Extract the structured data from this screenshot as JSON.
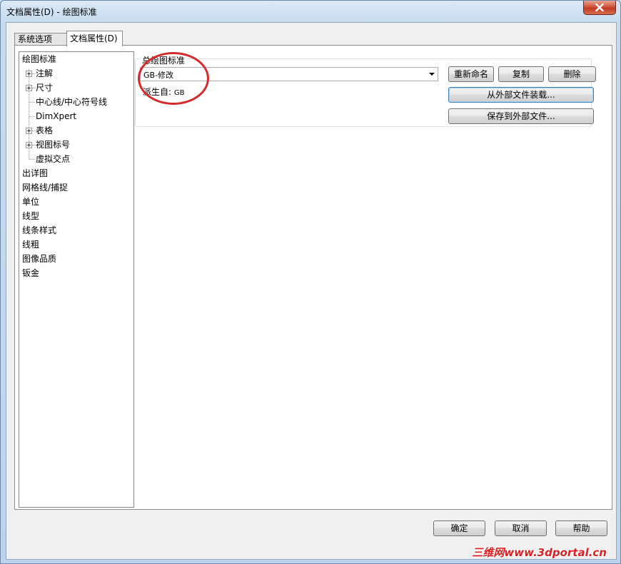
{
  "window": {
    "title": "文档属性(D) - 绘图标准"
  },
  "tabs": [
    {
      "label": "系统选项(S)",
      "active": false
    },
    {
      "label": "文档属性(D)",
      "active": true
    }
  ],
  "tree": {
    "items": [
      {
        "label": "绘图标准",
        "level": 0,
        "expandable": false
      },
      {
        "label": "注解",
        "level": 1,
        "expandable": true
      },
      {
        "label": "尺寸",
        "level": 1,
        "expandable": true
      },
      {
        "label": "中心线/中心符号线",
        "level": 1,
        "expandable": false
      },
      {
        "label": "DimXpert",
        "level": 1,
        "expandable": false
      },
      {
        "label": "表格",
        "level": 1,
        "expandable": true
      },
      {
        "label": "视图标号",
        "level": 1,
        "expandable": true
      },
      {
        "label": "虚拟交点",
        "level": 1,
        "expandable": false
      },
      {
        "label": "出详图",
        "level": 0,
        "expandable": false
      },
      {
        "label": "网格线/捕捉",
        "level": 0,
        "expandable": false
      },
      {
        "label": "单位",
        "level": 0,
        "expandable": false
      },
      {
        "label": "线型",
        "level": 0,
        "expandable": false
      },
      {
        "label": "线条样式",
        "level": 0,
        "expandable": false
      },
      {
        "label": "线粗",
        "level": 0,
        "expandable": false
      },
      {
        "label": "图像品质",
        "level": 0,
        "expandable": false
      },
      {
        "label": "钣金",
        "level": 0,
        "expandable": false
      }
    ]
  },
  "standard": {
    "group_label": "总绘图标准",
    "selected": "GB-修改",
    "derived_label": "派生自:",
    "derived_value": "GB",
    "rename_button": "重新命名",
    "copy_button": "复制",
    "delete_button": "删除",
    "load_button": "从外部文件装载...",
    "save_button": "保存到外部文件..."
  },
  "footer": {
    "ok_button": "确定",
    "cancel_button": "取消",
    "help_button": "帮助"
  },
  "watermark": "三维网www.3dportal.cn",
  "colors": {
    "annotation_circle": "#d42a2a",
    "watermark": "#d82222"
  }
}
